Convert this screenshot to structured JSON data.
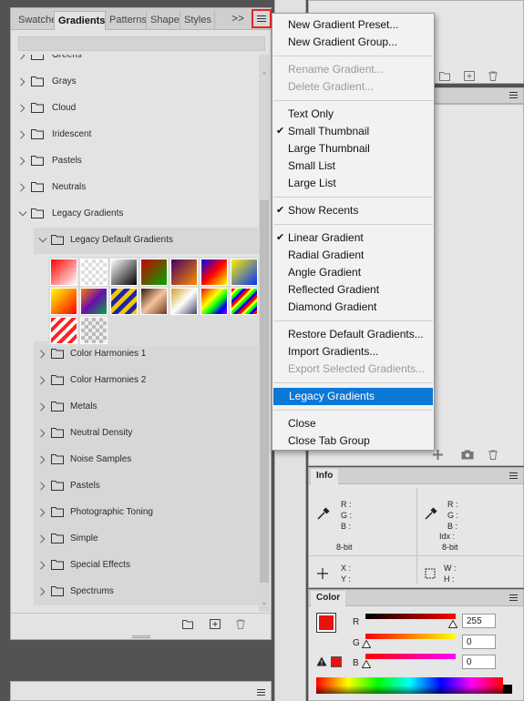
{
  "tabs": [
    "Swatches",
    "Gradients",
    "Patterns",
    "Shapes",
    "Styles"
  ],
  "tab_overflow": ">>",
  "tree": [
    {
      "label": "Greens",
      "level": 0
    },
    {
      "label": "Grays",
      "level": 0
    },
    {
      "label": "Cloud",
      "level": 0
    },
    {
      "label": "Iridescent",
      "level": 0
    },
    {
      "label": "Pastels",
      "level": 0
    },
    {
      "label": "Neutrals",
      "level": 0
    },
    {
      "label": "Legacy Gradients",
      "level": 0,
      "expanded": true
    },
    {
      "label": "Legacy Default Gradients",
      "level": 1,
      "expanded": true
    },
    {
      "label": "Color Harmonies 1",
      "level": 1
    },
    {
      "label": "Color Harmonies 2",
      "level": 1
    },
    {
      "label": "Metals",
      "level": 1
    },
    {
      "label": "Neutral Density",
      "level": 1
    },
    {
      "label": "Noise Samples",
      "level": 1
    },
    {
      "label": "Pastels",
      "level": 1
    },
    {
      "label": "Photographic Toning",
      "level": 1
    },
    {
      "label": "Simple",
      "level": 1
    },
    {
      "label": "Special Effects",
      "level": 1
    },
    {
      "label": "Spectrums",
      "level": 1
    }
  ],
  "menu": [
    {
      "label": "New Gradient Preset..."
    },
    {
      "label": "New Gradient Group..."
    },
    {
      "sep": true
    },
    {
      "label": "Rename Gradient...",
      "disabled": true
    },
    {
      "label": "Delete Gradient...",
      "disabled": true
    },
    {
      "sep": true
    },
    {
      "label": "Text Only"
    },
    {
      "label": "Small Thumbnail",
      "checked": true
    },
    {
      "label": "Large Thumbnail"
    },
    {
      "label": "Small List"
    },
    {
      "label": "Large List"
    },
    {
      "sep": true
    },
    {
      "label": "Show Recents",
      "checked": true
    },
    {
      "sep": true
    },
    {
      "label": "Linear Gradient",
      "checked": true
    },
    {
      "label": "Radial Gradient"
    },
    {
      "label": "Angle Gradient"
    },
    {
      "label": "Reflected Gradient"
    },
    {
      "label": "Diamond Gradient"
    },
    {
      "sep": true
    },
    {
      "label": "Restore Default Gradients..."
    },
    {
      "label": "Import Gradients..."
    },
    {
      "label": "Export Selected Gradients...",
      "disabled": true
    },
    {
      "sep": true
    },
    {
      "label": "Legacy Gradients",
      "highlighted": true
    },
    {
      "sep": true
    },
    {
      "label": "Close"
    },
    {
      "label": "Close Tab Group"
    }
  ],
  "info": {
    "tab": "Info",
    "left": {
      "r": "R :",
      "g": "G :",
      "b": "B :",
      "bits": "8-bit"
    },
    "right": {
      "r": "R :",
      "g": "G :",
      "b": "B :",
      "idx": "Idx :",
      "bits": "8-bit"
    },
    "xy": {
      "x": "X :",
      "y": "Y :"
    },
    "wh": {
      "w": "W :",
      "h": "H :"
    }
  },
  "color": {
    "tab": "Color",
    "fg": "#e8130f",
    "channels": [
      {
        "label": "R",
        "value": "255"
      },
      {
        "label": "G",
        "value": "0"
      },
      {
        "label": "B",
        "value": "0"
      }
    ]
  },
  "colors": {
    "highlight": "#0b78d7",
    "menu_button_border": "#e3262b"
  }
}
